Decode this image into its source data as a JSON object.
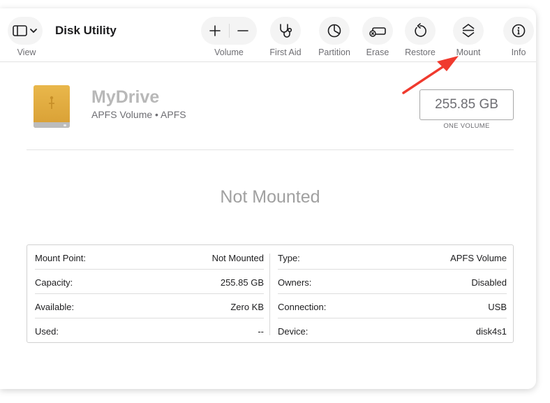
{
  "app": {
    "title": "Disk Utility"
  },
  "toolbar": {
    "view_label": "View",
    "volume_label": "Volume",
    "first_aid_label": "First Aid",
    "partition_label": "Partition",
    "erase_label": "Erase",
    "restore_label": "Restore",
    "mount_label": "Mount",
    "info_label": "Info"
  },
  "drive": {
    "name": "MyDrive",
    "subtitle": "APFS Volume • APFS",
    "size": "255.85 GB",
    "size_caption": "ONE VOLUME"
  },
  "status": {
    "text": "Not Mounted"
  },
  "details": {
    "left": [
      {
        "key": "Mount Point:",
        "value": "Not Mounted"
      },
      {
        "key": "Capacity:",
        "value": "255.85 GB"
      },
      {
        "key": "Available:",
        "value": "Zero KB"
      },
      {
        "key": "Used:",
        "value": "--"
      }
    ],
    "right": [
      {
        "key": "Type:",
        "value": "APFS Volume"
      },
      {
        "key": "Owners:",
        "value": "Disabled"
      },
      {
        "key": "Connection:",
        "value": "USB"
      },
      {
        "key": "Device:",
        "value": "disk4s1"
      }
    ]
  },
  "colors": {
    "annotation_arrow": "#f03a2e",
    "drive_icon": "#e3ad42"
  }
}
